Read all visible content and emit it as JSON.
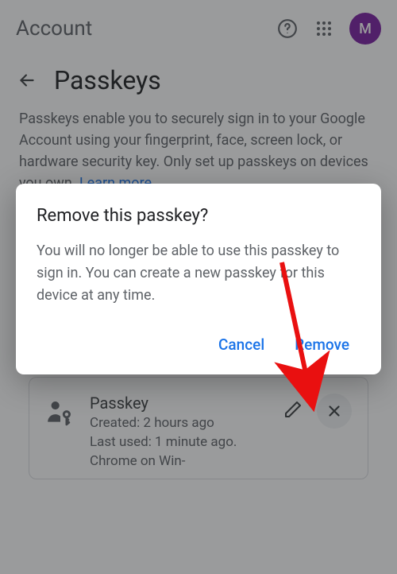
{
  "header": {
    "title": "Account",
    "avatar_initial": "M"
  },
  "page": {
    "title": "Passkeys",
    "description": "Passkeys enable you to securely sign in to your Google Account using your fingerprint, face, screen lock, or hardware security key. Only set up passkeys on devices you own. ",
    "learn_more": "Learn more"
  },
  "passkey_card": {
    "title": "Passkey",
    "created": "Created: 2 hours ago",
    "last_used": "Last used: 1 minute ago. Chrome on Win-"
  },
  "dialog": {
    "title": "Remove this passkey?",
    "body": "You will no longer be able to use this passkey to sign in. You can create a new passkey for this device at any time.",
    "cancel": "Cancel",
    "remove": "Remove"
  },
  "colors": {
    "link": "#1a73e8",
    "avatar_bg": "#7b1fa2"
  }
}
